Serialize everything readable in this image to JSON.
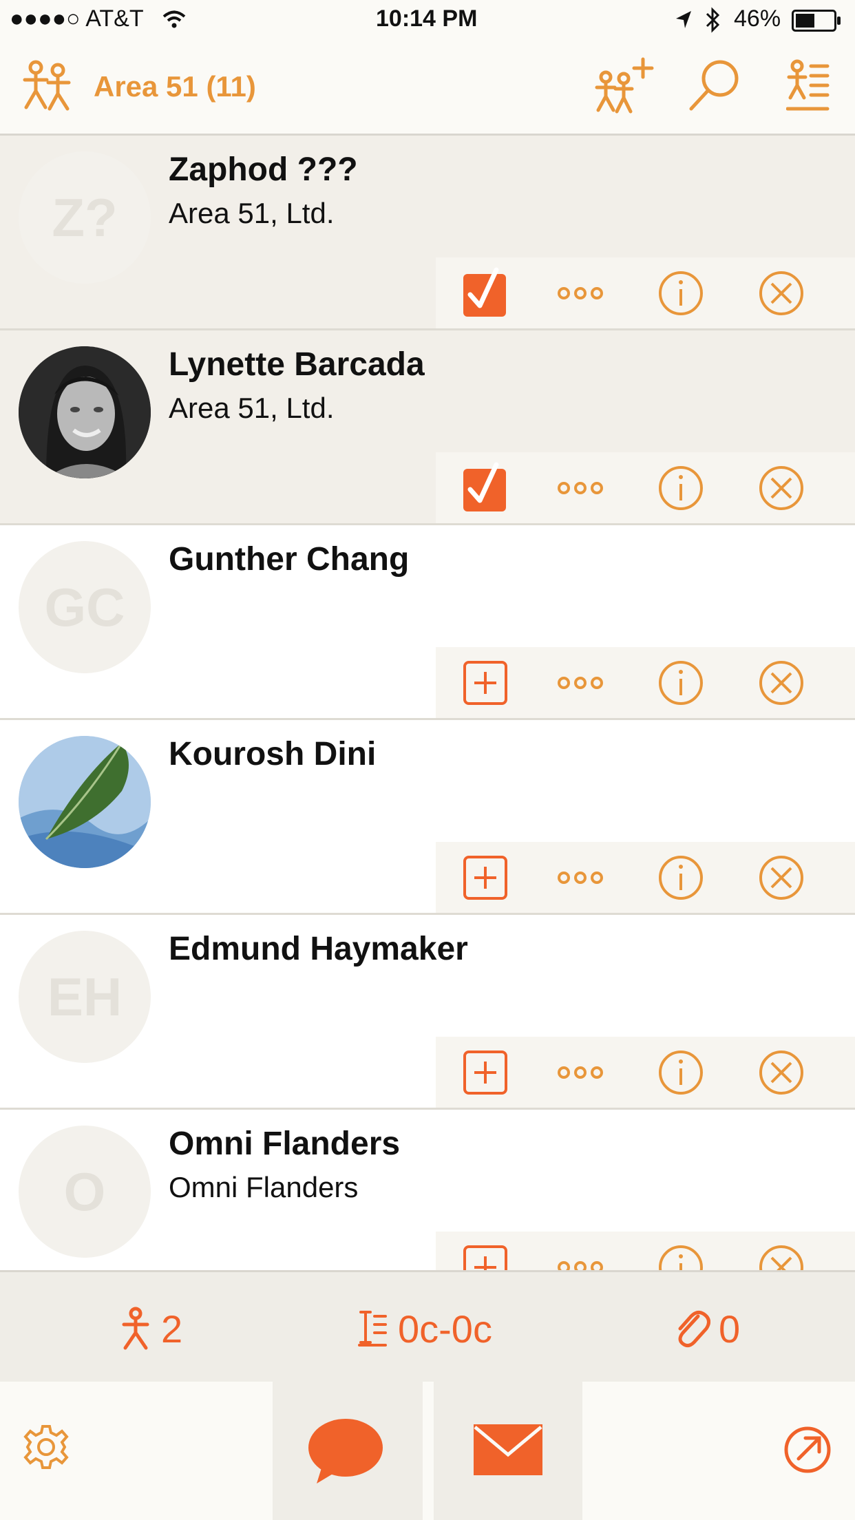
{
  "status_bar": {
    "carrier": "●●●●○ AT&T",
    "time": "10:14 PM",
    "battery": "46%"
  },
  "nav": {
    "title": "Area 51 (11)",
    "icons": [
      "group-icon",
      "add-contact-icon",
      "search-icon",
      "sort-list-icon"
    ]
  },
  "contacts": [
    {
      "name": "Zaphod ???",
      "company": "Area 51, Ltd.",
      "initials": "Z?",
      "selected": true,
      "photo": false
    },
    {
      "name": "Lynette Barcada",
      "company": "Area 51, Ltd.",
      "initials": "",
      "selected": true,
      "photo": true
    },
    {
      "name": "Gunther Chang",
      "company": "",
      "initials": "GC",
      "selected": false,
      "photo": false
    },
    {
      "name": "Kourosh Dini",
      "company": "",
      "initials": "",
      "selected": false,
      "photo": true
    },
    {
      "name": "Edmund Haymaker",
      "company": "",
      "initials": "EH",
      "selected": false,
      "photo": false
    },
    {
      "name": "Omni Flanders",
      "company": "Omni Flanders",
      "initials": "O",
      "selected": false,
      "photo": false
    }
  ],
  "stats": {
    "people_count": "2",
    "notes_range": "0c-0c",
    "attachments_count": "0"
  },
  "colors": {
    "accent_orange": "#f0622a",
    "nav_orange": "#e8963a"
  }
}
